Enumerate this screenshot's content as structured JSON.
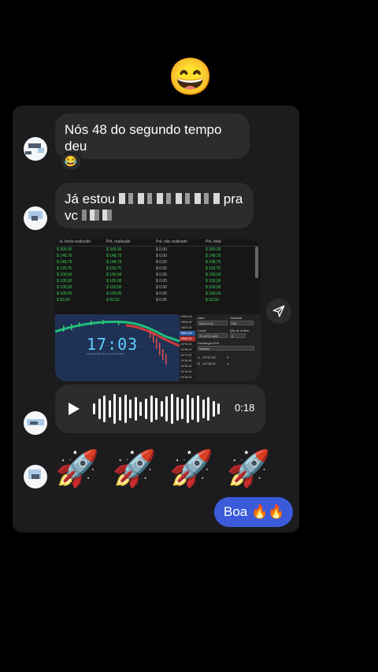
{
  "header": {
    "emoji": "😄"
  },
  "messages": [
    {
      "text": "Nós 48 do segundo tempo deu",
      "emoji": "😄",
      "reaction": "😂"
    },
    {
      "text_start": "Já estou",
      "text_mid": "pra",
      "text_end": "vc"
    }
  ],
  "screenshot": {
    "columns": [
      "PnL bruto realizado",
      "PnL realizado",
      "PnL não realizado",
      "PnL total"
    ],
    "rows": [
      [
        "$ 300,00",
        "$ 300,00",
        "$ 0,00",
        "$ 300,00"
      ],
      [
        "$ 148,75",
        "$ 148,75",
        "$ 0,00",
        "$ 148,75"
      ],
      [
        "$ 148,75",
        "$ 148,75",
        "$ 0,00",
        "$ 148,75"
      ],
      [
        "$ 118,75",
        "$ 118,75",
        "$ 0,00",
        "$ 118,75"
      ],
      [
        "$ 100,00",
        "$ 100,00",
        "$ 0,00",
        "$ 100,00"
      ],
      [
        "$ 100,00",
        "$ 100,00",
        "$ 0,00",
        "$ 100,00"
      ],
      [
        "$ 100,00",
        "$ 100,00",
        "$ 0,00",
        "$ 100,00"
      ],
      [
        "$ 100,00",
        "$ 100,00",
        "$ 0,00",
        "$ 100,00"
      ],
      [
        "$ 92,50",
        "$ 92,50",
        "$ 0,00",
        "$ 92,50"
      ]
    ],
    "clock": "17:03",
    "clock_sub": "segunda-feira, 26 de junho de 2023",
    "ladder": [
      "19840,00",
      "19830,00",
      "19820,00",
      "19810,00",
      "19800,00",
      "19790,00",
      "19780,00",
      "19770,00",
      "19760,00",
      "19750,00",
      "19740,00",
      "19736,50"
    ],
    "order_panel": {
      "ativo_label": "Ativo",
      "ativo_value": "NAQ 09-23",
      "validade_label": "Validade",
      "validade_value": "DAY",
      "conta_label": "Conta",
      "conta_value": "TR-APEX-6669",
      "qty_label": "Qty de ordem",
      "qty_value": "3",
      "estrategia_label": "Estratégia ATM",
      "estrategia_value": "Nenhum",
      "a_label": "A",
      "a_price": "19737,00",
      "a_qty": "5",
      "b_label": "B",
      "b_price": "19736,50",
      "b_qty": "4"
    },
    "colors": {
      "profit_green": "#39d353",
      "chart_bg": "#1f3154",
      "clock_blue": "#5cd0ff"
    }
  },
  "share_icon": "send-icon",
  "voice": {
    "duration": "0:18",
    "play_icon": "play-icon"
  },
  "rockets": "🚀 🚀 🚀 🚀",
  "sent": {
    "text": "Boa",
    "emoji": "🔥🔥",
    "color": "#3b5bdb"
  }
}
